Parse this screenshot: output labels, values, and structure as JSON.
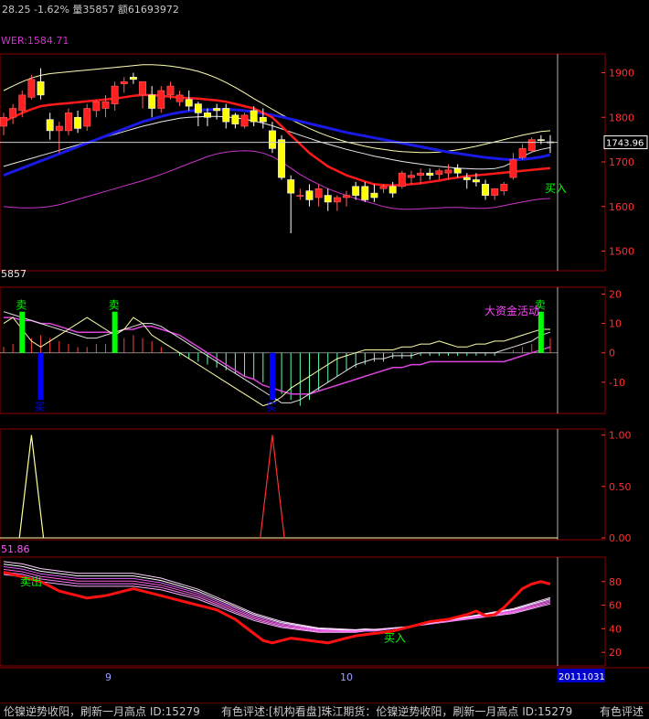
{
  "header": {
    "quote": "28.25 -1.62% 量35857 额61693972",
    "pane1_label": "WER:1584.71",
    "pane2_label": "5857",
    "pane4_label": "51.86"
  },
  "price_axis": {
    "ticks": [
      "1900",
      "1800",
      "1700",
      "1600",
      "1500"
    ],
    "current": "1743.96"
  },
  "macd_axis": {
    "ticks": [
      "20",
      "10",
      "0",
      "-10"
    ]
  },
  "signal_axis": {
    "ticks": [
      "1.00",
      "0.50",
      "0.00"
    ]
  },
  "osc_axis": {
    "ticks": [
      "80",
      "60",
      "40",
      "20"
    ]
  },
  "annotations": {
    "sell": "卖",
    "buy_short": "买",
    "big_fund": "大资金活动",
    "buy": "买入",
    "sell_out": "卖出"
  },
  "time_axis": {
    "labels": [
      "9",
      "10"
    ],
    "last_date": "20111031"
  },
  "ticker": {
    "text1": "伦镍逆势收阳，刷新一月高点 ID:15279",
    "text2": "有色评述:[机构看盘]珠江期货：伦镍逆势收阳，刷新一月高点 ID:15279",
    "text3": "有色评述"
  },
  "colors": {
    "bull": "#ff2020",
    "bear": "#ffff00",
    "grid": "#8b0000",
    "axis_text": "#ff3030",
    "ma_red": "#ff1a1a",
    "ma_blue": "#1a1ae6",
    "ma_white": "#e8e8e8",
    "band_magenta": "#cc33cc",
    "band_yellow": "#ffffb0",
    "sell_green": "#00ff00",
    "buy_blue": "#0000ff",
    "cyan": "#00ffff"
  },
  "chart_data": [
    {
      "type": "candlestick",
      "y_axis_ticks": [
        1900,
        1800,
        1700,
        1600,
        1500
      ],
      "ylim": [
        1460,
        1940
      ],
      "current_price": 1743.96,
      "candles": [
        {
          "o": 1780,
          "h": 1810,
          "l": 1760,
          "c": 1800
        },
        {
          "o": 1800,
          "h": 1830,
          "l": 1785,
          "c": 1820
        },
        {
          "o": 1815,
          "h": 1860,
          "l": 1800,
          "c": 1850
        },
        {
          "o": 1845,
          "h": 1895,
          "l": 1840,
          "c": 1885
        },
        {
          "o": 1880,
          "h": 1910,
          "l": 1840,
          "c": 1850
        },
        {
          "o": 1795,
          "h": 1810,
          "l": 1750,
          "c": 1770
        },
        {
          "o": 1770,
          "h": 1790,
          "l": 1720,
          "c": 1780
        },
        {
          "o": 1770,
          "h": 1820,
          "l": 1760,
          "c": 1810
        },
        {
          "o": 1800,
          "h": 1815,
          "l": 1765,
          "c": 1775
        },
        {
          "o": 1780,
          "h": 1830,
          "l": 1770,
          "c": 1820
        },
        {
          "o": 1815,
          "h": 1840,
          "l": 1800,
          "c": 1835
        },
        {
          "o": 1820,
          "h": 1850,
          "l": 1800,
          "c": 1835
        },
        {
          "o": 1830,
          "h": 1880,
          "l": 1815,
          "c": 1870
        },
        {
          "o": 1875,
          "h": 1890,
          "l": 1855,
          "c": 1880
        },
        {
          "o": 1890,
          "h": 1900,
          "l": 1875,
          "c": 1885
        },
        {
          "o": 1850,
          "h": 1880,
          "l": 1820,
          "c": 1880
        },
        {
          "o": 1850,
          "h": 1870,
          "l": 1800,
          "c": 1820
        },
        {
          "o": 1820,
          "h": 1870,
          "l": 1810,
          "c": 1860
        },
        {
          "o": 1850,
          "h": 1880,
          "l": 1840,
          "c": 1870
        },
        {
          "o": 1835,
          "h": 1860,
          "l": 1825,
          "c": 1850
        },
        {
          "o": 1840,
          "h": 1860,
          "l": 1815,
          "c": 1825
        },
        {
          "o": 1830,
          "h": 1835,
          "l": 1780,
          "c": 1810
        },
        {
          "o": 1810,
          "h": 1820,
          "l": 1780,
          "c": 1800
        },
        {
          "o": 1820,
          "h": 1830,
          "l": 1795,
          "c": 1815
        },
        {
          "o": 1820,
          "h": 1830,
          "l": 1775,
          "c": 1790
        },
        {
          "o": 1805,
          "h": 1810,
          "l": 1775,
          "c": 1785
        },
        {
          "o": 1780,
          "h": 1810,
          "l": 1775,
          "c": 1805
        },
        {
          "o": 1815,
          "h": 1825,
          "l": 1780,
          "c": 1790
        },
        {
          "o": 1800,
          "h": 1820,
          "l": 1775,
          "c": 1790
        },
        {
          "o": 1770,
          "h": 1790,
          "l": 1720,
          "c": 1730
        },
        {
          "o": 1750,
          "h": 1760,
          "l": 1660,
          "c": 1665
        },
        {
          "o": 1660,
          "h": 1670,
          "l": 1540,
          "c": 1630
        },
        {
          "o": 1625,
          "h": 1640,
          "l": 1615,
          "c": 1625
        },
        {
          "o": 1635,
          "h": 1650,
          "l": 1600,
          "c": 1615
        },
        {
          "o": 1620,
          "h": 1650,
          "l": 1600,
          "c": 1640
        },
        {
          "o": 1625,
          "h": 1640,
          "l": 1590,
          "c": 1610
        },
        {
          "o": 1610,
          "h": 1625,
          "l": 1590,
          "c": 1620
        },
        {
          "o": 1620,
          "h": 1635,
          "l": 1600,
          "c": 1625
        },
        {
          "o": 1645,
          "h": 1655,
          "l": 1615,
          "c": 1625
        },
        {
          "o": 1645,
          "h": 1655,
          "l": 1610,
          "c": 1615
        },
        {
          "o": 1630,
          "h": 1650,
          "l": 1610,
          "c": 1620
        },
        {
          "o": 1640,
          "h": 1650,
          "l": 1630,
          "c": 1645
        },
        {
          "o": 1645,
          "h": 1655,
          "l": 1620,
          "c": 1630
        },
        {
          "o": 1645,
          "h": 1680,
          "l": 1640,
          "c": 1675
        },
        {
          "o": 1665,
          "h": 1680,
          "l": 1650,
          "c": 1670
        },
        {
          "o": 1670,
          "h": 1685,
          "l": 1650,
          "c": 1675
        },
        {
          "o": 1675,
          "h": 1685,
          "l": 1660,
          "c": 1670
        },
        {
          "o": 1672,
          "h": 1685,
          "l": 1660,
          "c": 1680
        },
        {
          "o": 1675,
          "h": 1695,
          "l": 1660,
          "c": 1682
        },
        {
          "o": 1685,
          "h": 1695,
          "l": 1665,
          "c": 1675
        },
        {
          "o": 1665,
          "h": 1675,
          "l": 1640,
          "c": 1660
        },
        {
          "o": 1660,
          "h": 1675,
          "l": 1645,
          "c": 1655
        },
        {
          "o": 1650,
          "h": 1660,
          "l": 1615,
          "c": 1625
        },
        {
          "o": 1625,
          "h": 1640,
          "l": 1615,
          "c": 1640
        },
        {
          "o": 1635,
          "h": 1655,
          "l": 1625,
          "c": 1650
        },
        {
          "o": 1665,
          "h": 1720,
          "l": 1660,
          "c": 1705
        },
        {
          "o": 1710,
          "h": 1740,
          "l": 1705,
          "c": 1730
        },
        {
          "o": 1725,
          "h": 1755,
          "l": 1720,
          "c": 1750
        },
        {
          "o": 1750,
          "h": 1760,
          "l": 1740,
          "c": 1748
        },
        {
          "o": 1745,
          "h": 1760,
          "l": 1720,
          "c": 1744
        }
      ],
      "ma_red": [
        1790,
        1800,
        1810,
        1818,
        1825,
        1828,
        1830,
        1832,
        1834,
        1836,
        1838,
        1840,
        1842,
        1845,
        1848,
        1850,
        1850,
        1848,
        1846,
        1844,
        1843,
        1842,
        1840,
        1838,
        1835,
        1830,
        1825,
        1820,
        1810,
        1800,
        1780,
        1760,
        1740,
        1720,
        1705,
        1690,
        1680,
        1670,
        1663,
        1656,
        1650,
        1648,
        1647,
        1648,
        1650,
        1652,
        1655,
        1658,
        1662,
        1665,
        1668,
        1670,
        1672,
        1674,
        1676,
        1678,
        1680,
        1682,
        1684,
        1686
      ],
      "ma_blue": [
        1670,
        1678,
        1686,
        1694,
        1702,
        1710,
        1718,
        1726,
        1734,
        1742,
        1750,
        1758,
        1766,
        1774,
        1782,
        1790,
        1796,
        1802,
        1807,
        1811,
        1814,
        1816,
        1817,
        1818,
        1818,
        1817,
        1815,
        1812,
        1809,
        1805,
        1801,
        1796,
        1791,
        1786,
        1781,
        1776,
        1771,
        1766,
        1762,
        1758,
        1754,
        1750,
        1746,
        1742,
        1738,
        1734,
        1730,
        1726,
        1722,
        1719,
        1716,
        1713,
        1710,
        1708,
        1706,
        1705,
        1706,
        1708,
        1711,
        1716
      ],
      "ma_white": [
        1690,
        1696,
        1702,
        1708,
        1714,
        1720,
        1726,
        1732,
        1738,
        1744,
        1750,
        1756,
        1762,
        1768,
        1774,
        1780,
        1785,
        1790,
        1794,
        1798,
        1800,
        1801,
        1802,
        1802,
        1801,
        1799,
        1796,
        1792,
        1787,
        1781,
        1774,
        1767,
        1760,
        1753,
        1746,
        1740,
        1734,
        1728,
        1723,
        1718,
        1713,
        1709,
        1705,
        1701,
        1698,
        1695,
        1692,
        1690,
        1688,
        1686,
        1685,
        1684,
        1684,
        1685,
        1690,
        1700,
        1712,
        1722,
        1728,
        1732
      ],
      "band_upper": [
        1860,
        1870,
        1880,
        1888,
        1894,
        1898,
        1900,
        1902,
        1904,
        1906,
        1908,
        1910,
        1912,
        1914,
        1916,
        1918,
        1918,
        1917,
        1915,
        1912,
        1908,
        1903,
        1896,
        1888,
        1878,
        1867,
        1855,
        1842,
        1830,
        1818,
        1806,
        1795,
        1785,
        1775,
        1766,
        1758,
        1751,
        1745,
        1740,
        1735,
        1731,
        1728,
        1725,
        1723,
        1722,
        1721,
        1721,
        1722,
        1724,
        1727,
        1731,
        1735,
        1740,
        1745,
        1750,
        1755,
        1760,
        1764,
        1768,
        1770
      ],
      "band_lower": [
        1600,
        1598,
        1597,
        1597,
        1598,
        1600,
        1604,
        1610,
        1616,
        1622,
        1628,
        1634,
        1640,
        1646,
        1652,
        1658,
        1665,
        1672,
        1680,
        1688,
        1696,
        1704,
        1712,
        1718,
        1722,
        1724,
        1725,
        1724,
        1720,
        1712,
        1700,
        1686,
        1672,
        1660,
        1650,
        1640,
        1632,
        1625,
        1618,
        1612,
        1606,
        1600,
        1596,
        1594,
        1594,
        1595,
        1596,
        1597,
        1598,
        1598,
        1597,
        1596,
        1596,
        1598,
        1602,
        1606,
        1610,
        1614,
        1617,
        1618
      ]
    },
    {
      "type": "bar",
      "name": "macd",
      "ylim": [
        -20,
        22
      ],
      "y_axis_ticks": [
        20,
        10,
        0,
        -10
      ],
      "histogram": [
        2,
        3,
        4,
        5,
        6,
        5,
        4,
        3,
        2,
        2,
        3,
        3,
        4,
        5,
        6,
        5,
        4,
        2,
        0,
        -1,
        -2,
        -3,
        -4,
        -5,
        -6,
        -7,
        -8,
        -9,
        -10,
        -12,
        -14,
        -16,
        -18,
        -16,
        -13,
        -10,
        -8,
        -6,
        -5,
        -4,
        -3,
        -3,
        -2,
        -2,
        -2,
        -1,
        -1,
        -1,
        -1,
        -1,
        -1,
        -1,
        -1,
        -1,
        0,
        1,
        2,
        3,
        4,
        5
      ],
      "line_white": [
        14,
        13,
        12,
        11,
        10,
        9,
        8,
        7,
        6,
        5,
        5,
        6,
        7,
        8,
        9,
        10,
        10,
        9,
        7,
        5,
        3,
        1,
        -1,
        -3,
        -5,
        -7,
        -9,
        -11,
        -13,
        -15,
        -17,
        -17,
        -16,
        -14,
        -12,
        -10,
        -8,
        -6,
        -4,
        -3,
        -2,
        -2,
        -1,
        -1,
        -1,
        0,
        0,
        0,
        0,
        0,
        0,
        0,
        0,
        0,
        1,
        2,
        3,
        4,
        6,
        7
      ],
      "line_magenta": [
        12,
        12,
        11,
        11,
        10,
        10,
        9,
        8,
        7,
        7,
        7,
        7,
        7,
        8,
        8,
        9,
        9,
        8,
        7,
        6,
        4,
        2,
        0,
        -2,
        -4,
        -6,
        -8,
        -9,
        -11,
        -12,
        -13,
        -14,
        -14,
        -14,
        -13,
        -12,
        -11,
        -10,
        -9,
        -8,
        -7,
        -6,
        -5,
        -5,
        -4,
        -4,
        -3,
        -3,
        -3,
        -3,
        -3,
        -3,
        -3,
        -3,
        -3,
        -2,
        -1,
        0,
        1,
        2
      ],
      "line_yellow": [
        10,
        12,
        8,
        4,
        2,
        4,
        6,
        8,
        10,
        12,
        10,
        8,
        6,
        8,
        12,
        10,
        6,
        4,
        2,
        0,
        -2,
        -4,
        -6,
        -8,
        -10,
        -12,
        -14,
        -16,
        -18,
        -17,
        -15,
        -12,
        -10,
        -8,
        -6,
        -4,
        -2,
        -1,
        0,
        1,
        1,
        1,
        1,
        2,
        2,
        3,
        3,
        4,
        3,
        2,
        2,
        3,
        3,
        4,
        4,
        5,
        6,
        7,
        8,
        8
      ],
      "sell_signals": [
        2,
        12,
        58
      ],
      "buy_signals": [
        4,
        29
      ]
    },
    {
      "type": "line",
      "name": "signal",
      "ylim": [
        0,
        1.05
      ],
      "y_axis_ticks": [
        1.0,
        0.5,
        0.0
      ],
      "yellow_spike_index": 3,
      "red_spike_index": 29
    },
    {
      "type": "line",
      "name": "oscillator",
      "ylim": [
        10,
        100
      ],
      "y_axis_ticks": [
        80,
        60,
        40,
        20
      ],
      "main_red": [
        88,
        86,
        84,
        82,
        80,
        76,
        72,
        70,
        68,
        66,
        67,
        68,
        70,
        72,
        74,
        72,
        70,
        68,
        66,
        64,
        62,
        60,
        58,
        56,
        52,
        48,
        42,
        36,
        30,
        28,
        30,
        32,
        31,
        30,
        29,
        28,
        30,
        32,
        34,
        35,
        36,
        37,
        38,
        40,
        42,
        44,
        46,
        47,
        48,
        50,
        52,
        55,
        51,
        52,
        58,
        66,
        74,
        78,
        80,
        78
      ],
      "fan_base": [
        86,
        85,
        84,
        82,
        80,
        79,
        78,
        77,
        76,
        76,
        76,
        76,
        76,
        76,
        76,
        75,
        74,
        73,
        71,
        69,
        67,
        65,
        62,
        59,
        56,
        53,
        50,
        47,
        45,
        43,
        41,
        40,
        39,
        38,
        37,
        37,
        37,
        37,
        37,
        38,
        38,
        39,
        40,
        41,
        42,
        43,
        44,
        45,
        46,
        47,
        48,
        49,
        50,
        51,
        52,
        53,
        55,
        57,
        59,
        61
      ]
    }
  ]
}
